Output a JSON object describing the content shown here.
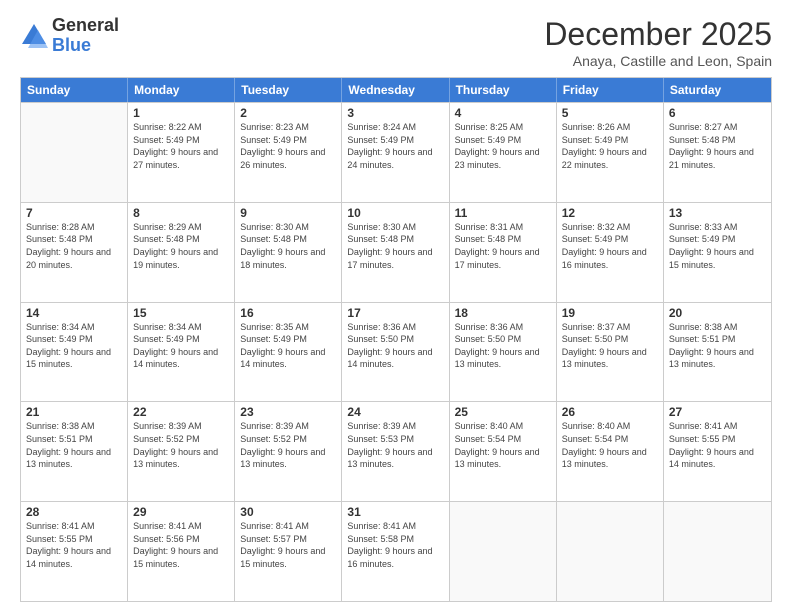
{
  "logo": {
    "general": "General",
    "blue": "Blue"
  },
  "title": {
    "month": "December 2025",
    "location": "Anaya, Castille and Leon, Spain"
  },
  "header_days": [
    "Sunday",
    "Monday",
    "Tuesday",
    "Wednesday",
    "Thursday",
    "Friday",
    "Saturday"
  ],
  "weeks": [
    [
      {
        "day": "",
        "empty": true
      },
      {
        "day": "1",
        "sunrise": "8:22 AM",
        "sunset": "5:49 PM",
        "daylight": "9 hours and 27 minutes."
      },
      {
        "day": "2",
        "sunrise": "8:23 AM",
        "sunset": "5:49 PM",
        "daylight": "9 hours and 26 minutes."
      },
      {
        "day": "3",
        "sunrise": "8:24 AM",
        "sunset": "5:49 PM",
        "daylight": "9 hours and 24 minutes."
      },
      {
        "day": "4",
        "sunrise": "8:25 AM",
        "sunset": "5:49 PM",
        "daylight": "9 hours and 23 minutes."
      },
      {
        "day": "5",
        "sunrise": "8:26 AM",
        "sunset": "5:49 PM",
        "daylight": "9 hours and 22 minutes."
      },
      {
        "day": "6",
        "sunrise": "8:27 AM",
        "sunset": "5:48 PM",
        "daylight": "9 hours and 21 minutes."
      }
    ],
    [
      {
        "day": "7",
        "sunrise": "8:28 AM",
        "sunset": "5:48 PM",
        "daylight": "9 hours and 20 minutes."
      },
      {
        "day": "8",
        "sunrise": "8:29 AM",
        "sunset": "5:48 PM",
        "daylight": "9 hours and 19 minutes."
      },
      {
        "day": "9",
        "sunrise": "8:30 AM",
        "sunset": "5:48 PM",
        "daylight": "9 hours and 18 minutes."
      },
      {
        "day": "10",
        "sunrise": "8:30 AM",
        "sunset": "5:48 PM",
        "daylight": "9 hours and 17 minutes."
      },
      {
        "day": "11",
        "sunrise": "8:31 AM",
        "sunset": "5:48 PM",
        "daylight": "9 hours and 17 minutes."
      },
      {
        "day": "12",
        "sunrise": "8:32 AM",
        "sunset": "5:49 PM",
        "daylight": "9 hours and 16 minutes."
      },
      {
        "day": "13",
        "sunrise": "8:33 AM",
        "sunset": "5:49 PM",
        "daylight": "9 hours and 15 minutes."
      }
    ],
    [
      {
        "day": "14",
        "sunrise": "8:34 AM",
        "sunset": "5:49 PM",
        "daylight": "9 hours and 15 minutes."
      },
      {
        "day": "15",
        "sunrise": "8:34 AM",
        "sunset": "5:49 PM",
        "daylight": "9 hours and 14 minutes."
      },
      {
        "day": "16",
        "sunrise": "8:35 AM",
        "sunset": "5:49 PM",
        "daylight": "9 hours and 14 minutes."
      },
      {
        "day": "17",
        "sunrise": "8:36 AM",
        "sunset": "5:50 PM",
        "daylight": "9 hours and 14 minutes."
      },
      {
        "day": "18",
        "sunrise": "8:36 AM",
        "sunset": "5:50 PM",
        "daylight": "9 hours and 13 minutes."
      },
      {
        "day": "19",
        "sunrise": "8:37 AM",
        "sunset": "5:50 PM",
        "daylight": "9 hours and 13 minutes."
      },
      {
        "day": "20",
        "sunrise": "8:38 AM",
        "sunset": "5:51 PM",
        "daylight": "9 hours and 13 minutes."
      }
    ],
    [
      {
        "day": "21",
        "sunrise": "8:38 AM",
        "sunset": "5:51 PM",
        "daylight": "9 hours and 13 minutes."
      },
      {
        "day": "22",
        "sunrise": "8:39 AM",
        "sunset": "5:52 PM",
        "daylight": "9 hours and 13 minutes."
      },
      {
        "day": "23",
        "sunrise": "8:39 AM",
        "sunset": "5:52 PM",
        "daylight": "9 hours and 13 minutes."
      },
      {
        "day": "24",
        "sunrise": "8:39 AM",
        "sunset": "5:53 PM",
        "daylight": "9 hours and 13 minutes."
      },
      {
        "day": "25",
        "sunrise": "8:40 AM",
        "sunset": "5:54 PM",
        "daylight": "9 hours and 13 minutes."
      },
      {
        "day": "26",
        "sunrise": "8:40 AM",
        "sunset": "5:54 PM",
        "daylight": "9 hours and 13 minutes."
      },
      {
        "day": "27",
        "sunrise": "8:41 AM",
        "sunset": "5:55 PM",
        "daylight": "9 hours and 14 minutes."
      }
    ],
    [
      {
        "day": "28",
        "sunrise": "8:41 AM",
        "sunset": "5:55 PM",
        "daylight": "9 hours and 14 minutes."
      },
      {
        "day": "29",
        "sunrise": "8:41 AM",
        "sunset": "5:56 PM",
        "daylight": "9 hours and 15 minutes."
      },
      {
        "day": "30",
        "sunrise": "8:41 AM",
        "sunset": "5:57 PM",
        "daylight": "9 hours and 15 minutes."
      },
      {
        "day": "31",
        "sunrise": "8:41 AM",
        "sunset": "5:58 PM",
        "daylight": "9 hours and 16 minutes."
      },
      {
        "day": "",
        "empty": true
      },
      {
        "day": "",
        "empty": true
      },
      {
        "day": "",
        "empty": true
      }
    ]
  ]
}
